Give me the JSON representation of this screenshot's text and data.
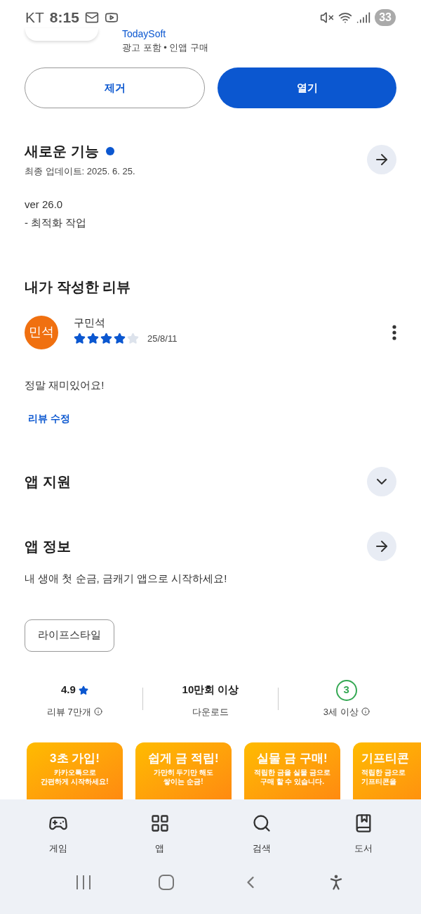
{
  "status_bar": {
    "carrier": "KT",
    "time": "8:15",
    "battery": "33"
  },
  "app_header": {
    "developer": "TodaySoft",
    "meta": "광고 포함 • 인앱 구매"
  },
  "actions": [
    {
      "label": "제거",
      "kind": "outline"
    },
    {
      "label": "열기",
      "kind": "filled"
    }
  ],
  "whats_new": {
    "title": "새로운 기능",
    "new_dot": true,
    "updated": "최종 업데이트: 2025. 6. 25.",
    "lines": [
      "ver 26.0",
      "- 최적화 작업"
    ]
  },
  "my_review": {
    "title": "내가 작성한 리뷰",
    "avatar": "민석",
    "author": "구민석",
    "stars": 4,
    "date": "25/8/11",
    "text": "정말 재미있어요!",
    "edit_link": "리뷰 수정"
  },
  "app_support": {
    "title": "앱 지원",
    "expanded": false
  },
  "app_info": {
    "title": "앱 정보",
    "description": "내 생애 첫 순금, 금캐기 앱으로 시작하세요!",
    "tag": "라이프스타일"
  },
  "stats": [
    {
      "kind": "rating",
      "value": "4.9",
      "label": "리뷰 7만개"
    },
    {
      "kind": "text",
      "value": "10만회 이상",
      "label": "다운로드"
    },
    {
      "kind": "age",
      "value": "3",
      "label": "3세 이상"
    }
  ],
  "screenshots": [
    {
      "title": "3초 가입!",
      "lines": [
        "카카오톡으로",
        "간편하게 시작하세요!"
      ]
    },
    {
      "title": "쉽게 금 적립!",
      "lines": [
        "가만히 두기만 해도",
        "쌓이는 순금!"
      ]
    },
    {
      "title": "실물 금 구매!",
      "lines": [
        "적립한 금을 실물 금으로",
        "구매 할 수 있습니다."
      ]
    },
    {
      "title": "기프티콘",
      "lines": [
        "적립한 금으로",
        "기프티콘을"
      ]
    }
  ],
  "bottom_nav": [
    {
      "label": "게임",
      "selected": false
    },
    {
      "label": "앱",
      "selected": false
    },
    {
      "label": "검색",
      "selected": false
    },
    {
      "label": "도서",
      "selected": false
    }
  ]
}
